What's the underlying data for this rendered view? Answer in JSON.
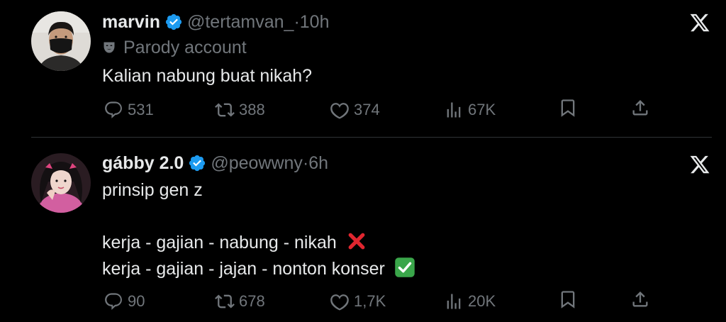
{
  "tweets": [
    {
      "name": "marvin",
      "handle": "@tertamvan_",
      "dot": "·",
      "time": "10h",
      "badge": "Parody account",
      "text": [
        "Kalian nabung buat nikah?"
      ],
      "replies": "531",
      "reposts": "388",
      "likes": "374",
      "views": "67K"
    },
    {
      "name": "gábby 2.0",
      "handle": "@peowwny",
      "dot": "·",
      "time": "6h",
      "text": [
        "prinsip gen z",
        "kerja - gajian - nabung - nikah",
        "kerja - gajian - jajan - nonton konser"
      ],
      "replies": "90",
      "reposts": "678",
      "likes": "1,7K",
      "views": "20K"
    }
  ],
  "icons": {
    "verified": "verified-badge-icon",
    "mask": "parody-mask-icon",
    "x": "x-logo-icon",
    "reply": "reply-icon",
    "repost": "repost-icon",
    "like": "like-icon",
    "views": "views-icon",
    "bookmark": "bookmark-icon",
    "share": "share-icon",
    "cross": "cross-mark-emoji",
    "check": "check-mark-emoji"
  },
  "colors": {
    "background": "#000000",
    "text": "#e7e9ea",
    "muted": "#71767b",
    "verified": "#1d9bf0",
    "divider": "#2f3336",
    "cross": "#e0262f",
    "check": "#3aa64a"
  }
}
